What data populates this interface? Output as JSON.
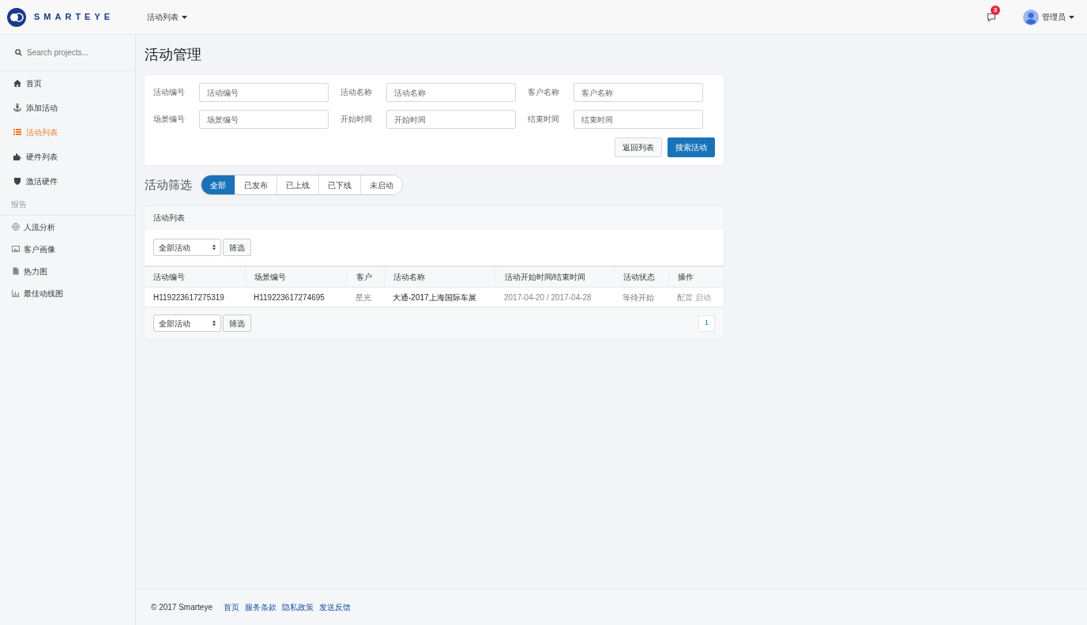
{
  "header": {
    "logo": "SMARTEYE",
    "menu": "活动列表",
    "notification_count": "3",
    "user": "管理员"
  },
  "sidebar": {
    "search_placeholder": "Search projects...",
    "items": [
      {
        "label": "首页",
        "selected": false
      },
      {
        "label": "添加活动",
        "selected": false
      },
      {
        "label": "活动列表",
        "selected": true
      },
      {
        "label": "硬件列表",
        "selected": false
      },
      {
        "label": "激活硬件",
        "selected": false
      }
    ],
    "section": "报告",
    "report_items": [
      {
        "label": "人流分析"
      },
      {
        "label": "客户画像"
      },
      {
        "label": "热力图"
      },
      {
        "label": "最佳动线图"
      }
    ]
  },
  "page_title": "活动管理",
  "search_form": {
    "fields": [
      {
        "label": "活动编号",
        "placeholder": "活动编号"
      },
      {
        "label": "活动名称",
        "placeholder": "活动名称"
      },
      {
        "label": "客户名称",
        "placeholder": "客户名称"
      },
      {
        "label": "场景编号",
        "placeholder": "场景编号"
      },
      {
        "label": "开始时间",
        "placeholder": "开始时间"
      },
      {
        "label": "结束时间",
        "placeholder": "结束时间"
      }
    ],
    "buttons": [
      "返回列表",
      "搜索活动"
    ]
  },
  "filter": {
    "title": "活动筛选",
    "tabs": [
      {
        "label": "全部",
        "selected": true
      },
      {
        "label": "已发布",
        "selected": false
      },
      {
        "label": "已上线",
        "selected": false
      },
      {
        "label": "已下线",
        "selected": false
      },
      {
        "label": "未启动",
        "selected": false
      }
    ]
  },
  "table_panel": {
    "title": "活动列表",
    "select": "全部活动",
    "filter_button": "筛选",
    "columns": [
      "活动编号",
      "场景编号",
      "客户",
      "活动名称",
      "活动开始时间/结束时间",
      "活动状态",
      "操作"
    ],
    "rows": [
      {
        "id": "H119223617275319",
        "scene": "H119223617274695",
        "customer": "星光",
        "name": "大通-2017上海国际车展",
        "dates": "2017-04-20 / 2017-04-28",
        "status": "等待开始",
        "actions": [
          "配置",
          "启动"
        ]
      }
    ],
    "bottom_select": "全部活动",
    "bottom_filter_button": "筛选",
    "pages": [
      {
        "label": "1",
        "selected": false
      }
    ]
  },
  "footer": {
    "copyright": "© 2017 Smarteye",
    "links": [
      "首页",
      "服务条款",
      "隐私政策",
      "发送反馈"
    ]
  }
}
